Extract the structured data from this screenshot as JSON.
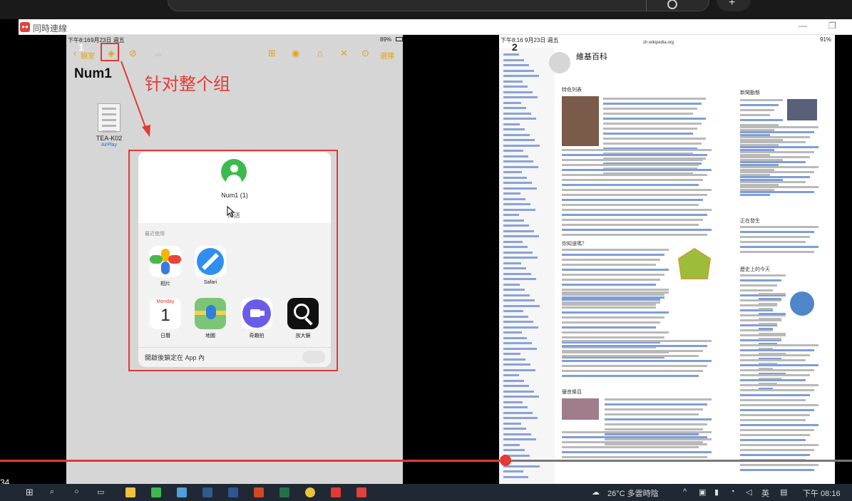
{
  "app_window": {
    "title": "同時連線"
  },
  "left_ipad": {
    "status_time": "下午8:16",
    "status_date": "9月23日 週五",
    "battery": "89%",
    "nav_back": "鏡室",
    "select_label": "選擇",
    "document_title": "Num1",
    "file_name": "TEA-K02",
    "file_source": "AirPlay"
  },
  "annotations": {
    "badge_left": "1",
    "badge_right": "2",
    "text": "针对整个组"
  },
  "share_sheet": {
    "target_name": "Num1 (1)",
    "target_action": "傳送",
    "recent_label": "最近使用",
    "apps_row1": [
      {
        "name": "相片",
        "icon": "photos-icon"
      },
      {
        "name": "Safari",
        "icon": "safari-icon"
      }
    ],
    "apps_row2": [
      {
        "name": "日曆",
        "icon": "calendar-icon"
      },
      {
        "name": "地圖",
        "icon": "maps-icon"
      },
      {
        "name": "奇趣拍",
        "icon": "clips-icon"
      },
      {
        "name": "放大鏡",
        "icon": "magnifier-icon"
      }
    ],
    "calendar_weekday": "Monday",
    "calendar_day": "1",
    "lock_app_label": "開啟後鎖定在 App 內"
  },
  "right_ipad": {
    "status_time": "下午8:16",
    "status_date": "9月23日 週五",
    "battery": "91%",
    "url": "zh.wikipedia.org",
    "site_name": "維基百科",
    "sections": [
      "特色列表",
      "你知道嗎？",
      "優良條目",
      "新聞動態",
      "正在發生",
      "歷史上的今天"
    ]
  },
  "video": {
    "elapsed": "34",
    "progress_fraction": 0.593
  },
  "taskbar": {
    "weather": "26°C 多雲時陰",
    "ime": "英",
    "clock": "下午 08:16"
  },
  "colors": {
    "annotation": "#e53935",
    "accent": "#e5a11a",
    "taskbar": "#1f2833"
  }
}
